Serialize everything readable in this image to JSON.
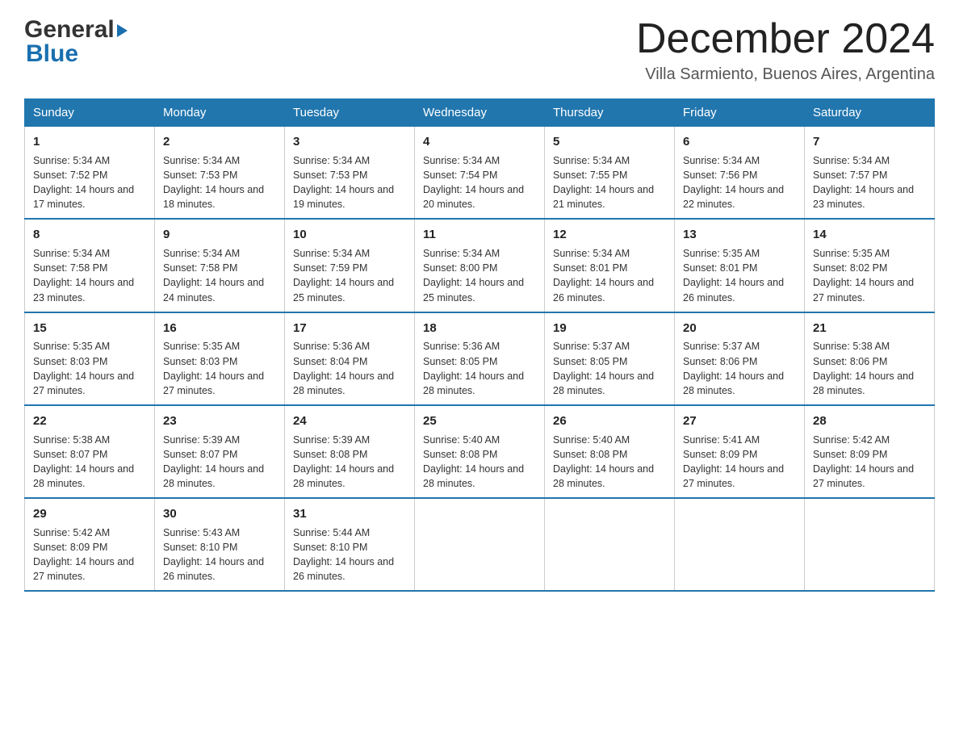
{
  "header": {
    "logo_general": "General",
    "logo_blue": "Blue",
    "month_title": "December 2024",
    "location": "Villa Sarmiento, Buenos Aires, Argentina"
  },
  "weekdays": [
    "Sunday",
    "Monday",
    "Tuesday",
    "Wednesday",
    "Thursday",
    "Friday",
    "Saturday"
  ],
  "weeks": [
    [
      {
        "day": "1",
        "sunrise": "5:34 AM",
        "sunset": "7:52 PM",
        "daylight": "14 hours and 17 minutes."
      },
      {
        "day": "2",
        "sunrise": "5:34 AM",
        "sunset": "7:53 PM",
        "daylight": "14 hours and 18 minutes."
      },
      {
        "day": "3",
        "sunrise": "5:34 AM",
        "sunset": "7:53 PM",
        "daylight": "14 hours and 19 minutes."
      },
      {
        "day": "4",
        "sunrise": "5:34 AM",
        "sunset": "7:54 PM",
        "daylight": "14 hours and 20 minutes."
      },
      {
        "day": "5",
        "sunrise": "5:34 AM",
        "sunset": "7:55 PM",
        "daylight": "14 hours and 21 minutes."
      },
      {
        "day": "6",
        "sunrise": "5:34 AM",
        "sunset": "7:56 PM",
        "daylight": "14 hours and 22 minutes."
      },
      {
        "day": "7",
        "sunrise": "5:34 AM",
        "sunset": "7:57 PM",
        "daylight": "14 hours and 23 minutes."
      }
    ],
    [
      {
        "day": "8",
        "sunrise": "5:34 AM",
        "sunset": "7:58 PM",
        "daylight": "14 hours and 23 minutes."
      },
      {
        "day": "9",
        "sunrise": "5:34 AM",
        "sunset": "7:58 PM",
        "daylight": "14 hours and 24 minutes."
      },
      {
        "day": "10",
        "sunrise": "5:34 AM",
        "sunset": "7:59 PM",
        "daylight": "14 hours and 25 minutes."
      },
      {
        "day": "11",
        "sunrise": "5:34 AM",
        "sunset": "8:00 PM",
        "daylight": "14 hours and 25 minutes."
      },
      {
        "day": "12",
        "sunrise": "5:34 AM",
        "sunset": "8:01 PM",
        "daylight": "14 hours and 26 minutes."
      },
      {
        "day": "13",
        "sunrise": "5:35 AM",
        "sunset": "8:01 PM",
        "daylight": "14 hours and 26 minutes."
      },
      {
        "day": "14",
        "sunrise": "5:35 AM",
        "sunset": "8:02 PM",
        "daylight": "14 hours and 27 minutes."
      }
    ],
    [
      {
        "day": "15",
        "sunrise": "5:35 AM",
        "sunset": "8:03 PM",
        "daylight": "14 hours and 27 minutes."
      },
      {
        "day": "16",
        "sunrise": "5:35 AM",
        "sunset": "8:03 PM",
        "daylight": "14 hours and 27 minutes."
      },
      {
        "day": "17",
        "sunrise": "5:36 AM",
        "sunset": "8:04 PM",
        "daylight": "14 hours and 28 minutes."
      },
      {
        "day": "18",
        "sunrise": "5:36 AM",
        "sunset": "8:05 PM",
        "daylight": "14 hours and 28 minutes."
      },
      {
        "day": "19",
        "sunrise": "5:37 AM",
        "sunset": "8:05 PM",
        "daylight": "14 hours and 28 minutes."
      },
      {
        "day": "20",
        "sunrise": "5:37 AM",
        "sunset": "8:06 PM",
        "daylight": "14 hours and 28 minutes."
      },
      {
        "day": "21",
        "sunrise": "5:38 AM",
        "sunset": "8:06 PM",
        "daylight": "14 hours and 28 minutes."
      }
    ],
    [
      {
        "day": "22",
        "sunrise": "5:38 AM",
        "sunset": "8:07 PM",
        "daylight": "14 hours and 28 minutes."
      },
      {
        "day": "23",
        "sunrise": "5:39 AM",
        "sunset": "8:07 PM",
        "daylight": "14 hours and 28 minutes."
      },
      {
        "day": "24",
        "sunrise": "5:39 AM",
        "sunset": "8:08 PM",
        "daylight": "14 hours and 28 minutes."
      },
      {
        "day": "25",
        "sunrise": "5:40 AM",
        "sunset": "8:08 PM",
        "daylight": "14 hours and 28 minutes."
      },
      {
        "day": "26",
        "sunrise": "5:40 AM",
        "sunset": "8:08 PM",
        "daylight": "14 hours and 28 minutes."
      },
      {
        "day": "27",
        "sunrise": "5:41 AM",
        "sunset": "8:09 PM",
        "daylight": "14 hours and 27 minutes."
      },
      {
        "day": "28",
        "sunrise": "5:42 AM",
        "sunset": "8:09 PM",
        "daylight": "14 hours and 27 minutes."
      }
    ],
    [
      {
        "day": "29",
        "sunrise": "5:42 AM",
        "sunset": "8:09 PM",
        "daylight": "14 hours and 27 minutes."
      },
      {
        "day": "30",
        "sunrise": "5:43 AM",
        "sunset": "8:10 PM",
        "daylight": "14 hours and 26 minutes."
      },
      {
        "day": "31",
        "sunrise": "5:44 AM",
        "sunset": "8:10 PM",
        "daylight": "14 hours and 26 minutes."
      },
      null,
      null,
      null,
      null
    ]
  ]
}
